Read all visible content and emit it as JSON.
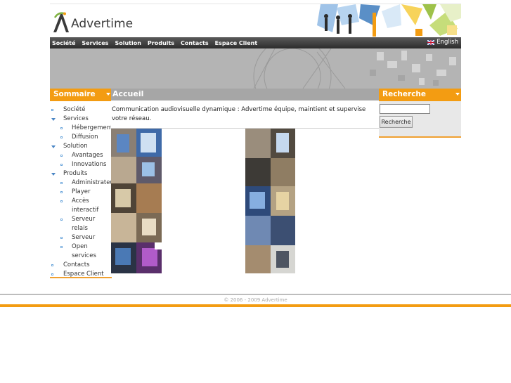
{
  "brand": {
    "name": "Advertime"
  },
  "nav": {
    "items": [
      "Société",
      "Services",
      "Solution",
      "Produits",
      "Contacts",
      "Espace Client"
    ],
    "lang": "English"
  },
  "sidebar": {
    "title": "Sommaire",
    "items": [
      {
        "label": "Société",
        "level": 1,
        "marker": "bullet"
      },
      {
        "label": "Services",
        "level": 1,
        "marker": "expanded"
      },
      {
        "label": "Hébergement",
        "level": 2,
        "marker": "bullet"
      },
      {
        "label": "Diffusion",
        "level": 2,
        "marker": "bullet"
      },
      {
        "label": "Solution",
        "level": 1,
        "marker": "expanded"
      },
      {
        "label": "Avantages",
        "level": 2,
        "marker": "bullet"
      },
      {
        "label": "Innovations",
        "level": 2,
        "marker": "bullet"
      },
      {
        "label": "Produits",
        "level": 1,
        "marker": "expanded"
      },
      {
        "label": "Administrateur",
        "level": 2,
        "marker": "bullet"
      },
      {
        "label": "Player",
        "level": 2,
        "marker": "bullet"
      },
      {
        "label": "Accès interactif",
        "level": 2,
        "marker": "bullet"
      },
      {
        "label": "Serveur relais",
        "level": 2,
        "marker": "bullet"
      },
      {
        "label": "Serveur",
        "level": 2,
        "marker": "bullet"
      },
      {
        "label": "Open services",
        "level": 2,
        "marker": "bullet"
      },
      {
        "label": "Contacts",
        "level": 1,
        "marker": "bullet"
      },
      {
        "label": "Espace Client",
        "level": 1,
        "marker": "bullet"
      }
    ]
  },
  "main": {
    "title": "Accueil",
    "description": "Communication audiovisuelle dynamique : Advertime équipe, maintient et supervise votre réseau."
  },
  "search": {
    "title": "Recherche",
    "input_value": "",
    "button_label": "Recherche"
  },
  "footer": {
    "copyright": "© 2006 - 2009 Advertime"
  },
  "colors": {
    "accent": "#f39c12",
    "nav_bg": "#3a3a3a",
    "band": "#b4b4b4",
    "bullet": "#6fa8dc"
  }
}
